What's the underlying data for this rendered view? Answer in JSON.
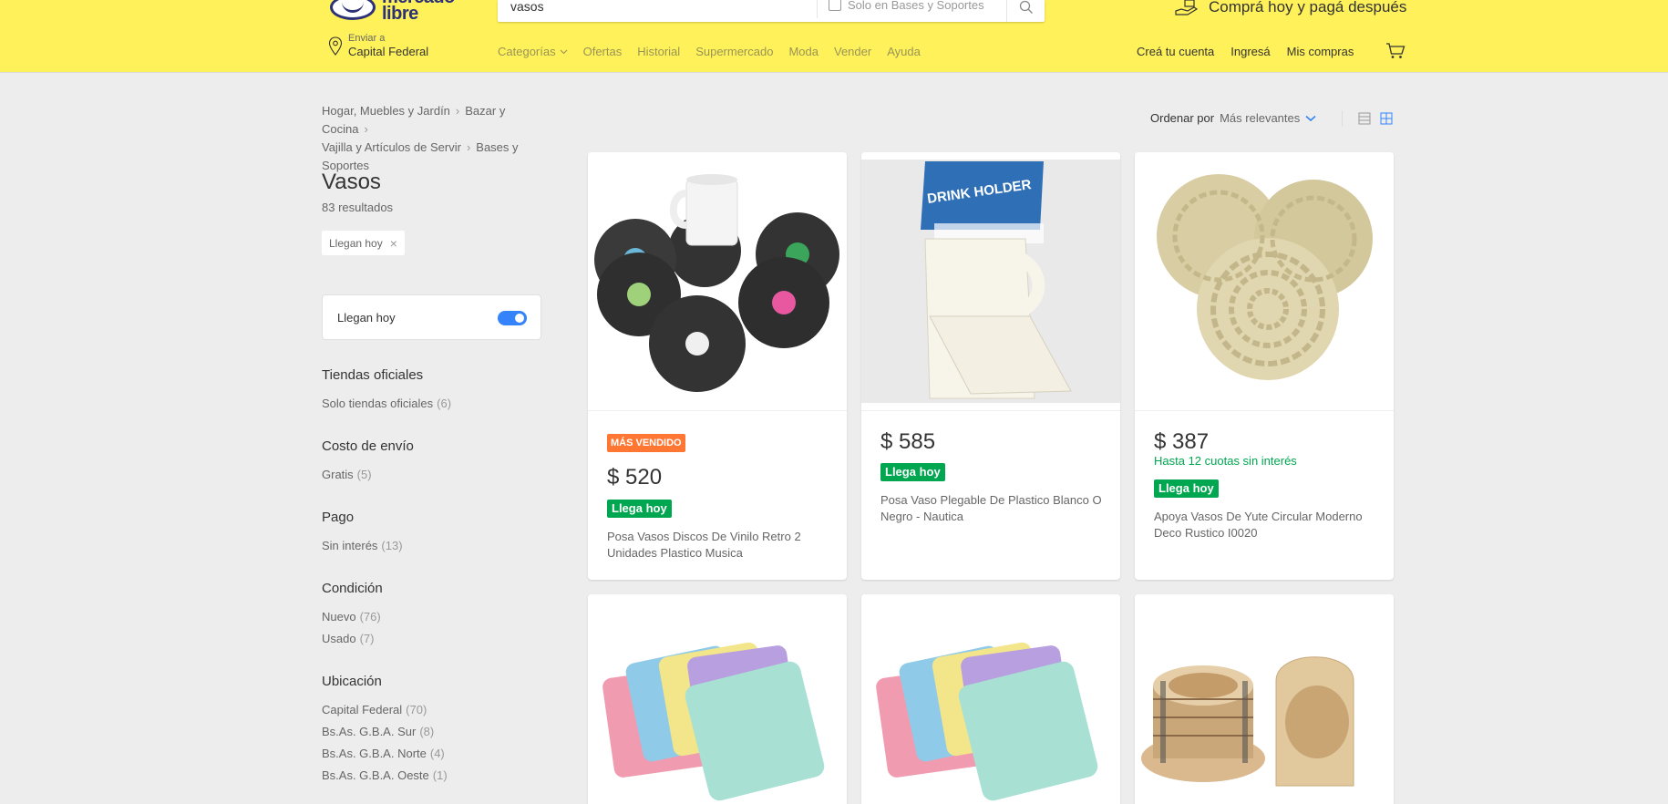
{
  "header": {
    "logo_text_1": "mercado",
    "logo_text_2": "libre",
    "search_value": "vasos",
    "search_scope_label": "Solo en Bases y Soportes",
    "promo": "Comprá hoy y pagá después",
    "location_small": "Enviar a",
    "location_big": "Capital Federal",
    "nav": [
      "Categorías",
      "Ofertas",
      "Historial",
      "Supermercado",
      "Moda",
      "Vender",
      "Ayuda"
    ],
    "user_nav": [
      "Creá tu cuenta",
      "Ingresá",
      "Mis compras"
    ]
  },
  "breadcrumb": [
    "Hogar, Muebles y Jardín",
    "Bazar y Cocina",
    "Vajilla y Artículos de Servir",
    "Bases y Soportes"
  ],
  "page_title": "Vasos",
  "results": "83 resultados",
  "applied_filter": "Llegan hoy",
  "toggle_label": "Llegan hoy",
  "filters": [
    {
      "title": "Tiendas oficiales",
      "items": [
        {
          "label": "Solo tiendas oficiales",
          "count": "(6)"
        }
      ]
    },
    {
      "title": "Costo de envío",
      "items": [
        {
          "label": "Gratis",
          "count": "(5)"
        }
      ]
    },
    {
      "title": "Pago",
      "items": [
        {
          "label": "Sin interés",
          "count": "(13)"
        }
      ]
    },
    {
      "title": "Condición",
      "items": [
        {
          "label": "Nuevo",
          "count": "(76)"
        },
        {
          "label": "Usado",
          "count": "(7)"
        }
      ]
    },
    {
      "title": "Ubicación",
      "items": [
        {
          "label": "Capital Federal",
          "count": "(70)"
        },
        {
          "label": "Bs.As. G.B.A. Sur",
          "count": "(8)"
        },
        {
          "label": "Bs.As. G.B.A. Norte",
          "count": "(4)"
        },
        {
          "label": "Bs.As. G.B.A. Oeste",
          "count": "(1)"
        }
      ]
    }
  ],
  "sort": {
    "label": "Ordenar por",
    "value": "Más relevantes"
  },
  "products": [
    {
      "badge": "MÁS VENDIDO",
      "price": "$ 520",
      "installments": "",
      "delivery": "Llega hoy",
      "title": "Posa Vasos Discos De Vinilo Retro 2 Unidades Plastico Musica"
    },
    {
      "badge": "",
      "price": "$ 585",
      "installments": "",
      "delivery": "Llega hoy",
      "title": "Posa Vaso Plegable De Plastico Blanco O Negro - Nautica",
      "image_text": "DRINK HOLDER"
    },
    {
      "badge": "",
      "price": "$ 387",
      "installments": "Hasta 12 cuotas sin interés",
      "delivery": "Llega hoy",
      "title": "Apoya Vasos De Yute Circular Moderno Deco Rustico I0020"
    },
    {
      "badge": "",
      "price": "",
      "installments": "",
      "delivery": "",
      "title": ""
    },
    {
      "badge": "",
      "price": "",
      "installments": "",
      "delivery": "",
      "title": ""
    },
    {
      "badge": "",
      "price": "",
      "installments": "",
      "delivery": "",
      "title": ""
    }
  ],
  "colors": {
    "header_bg": "#fff159",
    "accent": "#3483fa",
    "green": "#00a650",
    "orange": "#ff7733",
    "page_bg": "#ededed"
  }
}
